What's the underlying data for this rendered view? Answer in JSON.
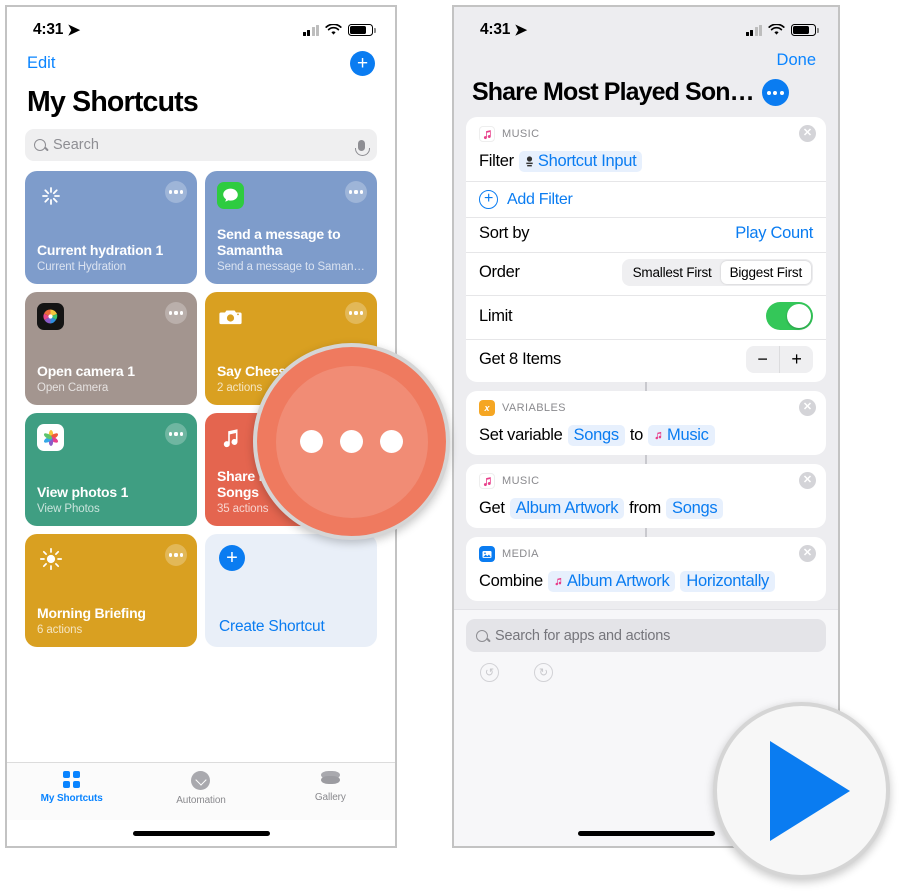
{
  "left_phone": {
    "status": {
      "time": "4:31",
      "location_arrow": "➤",
      "battery_pct": 70
    },
    "nav": {
      "edit_label": "Edit",
      "add_icon": "+"
    },
    "title": "My Shortcuts",
    "search": {
      "placeholder": "Search",
      "icon": "search-icon",
      "mic_icon": "microphone-icon"
    },
    "cards": [
      {
        "title": "Current hydration 1",
        "subtitle": "Current Hydration",
        "color": "#7e9ccb",
        "icon": "sparkle-icon",
        "glyph": "✳",
        "icon_bg": "transparent"
      },
      {
        "title": "Send a message to Samantha",
        "subtitle": "Send a message to Saman…",
        "color": "#7e9ccb",
        "icon": "messages-app-icon",
        "glyph": "💬",
        "icon_bg": "#2ecc40"
      },
      {
        "title": "Open camera 1",
        "subtitle": "Open Camera",
        "color": "#a3958f",
        "icon": "photos-editor-icon",
        "glyph": "◉",
        "icon_bg": "#1c1c1e"
      },
      {
        "title": "Say Cheese",
        "subtitle": "2 actions",
        "color": "#d9a021",
        "icon": "camera-icon",
        "glyph": "📷",
        "icon_bg": "transparent"
      },
      {
        "title": "View photos 1",
        "subtitle": "View Photos",
        "color": "#3f9e82",
        "icon": "photos-app-icon",
        "glyph": "❀",
        "icon_bg": "#ffffff"
      },
      {
        "title": "Share Most Played Songs",
        "subtitle": "35 actions",
        "color": "#e4654f",
        "icon": "music-note-icon",
        "glyph": "♫",
        "icon_bg": "transparent"
      },
      {
        "title": "Morning Briefing",
        "subtitle": "6 actions",
        "color": "#d9a021",
        "icon": "sun-icon",
        "glyph": "☀",
        "icon_bg": "transparent"
      }
    ],
    "create_card": {
      "label": "Create Shortcut",
      "icon": "plus-icon"
    },
    "tabs": [
      {
        "label": "My Shortcuts",
        "icon": "grid-icon",
        "active": true
      },
      {
        "label": "Automation",
        "icon": "clock-chevron-icon",
        "active": false
      },
      {
        "label": "Gallery",
        "icon": "layers-icon",
        "active": false
      }
    ]
  },
  "right_phone": {
    "status": {
      "time": "4:31",
      "location_arrow": "➤",
      "battery_pct": 70
    },
    "nav": {
      "done_label": "Done"
    },
    "title": "Share Most Played Son…",
    "more_button": "more-options-button",
    "action_cards": [
      {
        "app": "MUSIC",
        "app_icon": "music-note-icon",
        "app_icon_bg": "#ffffff",
        "rows": [
          {
            "type": "tokens",
            "label": "Filter",
            "token": "Shortcut Input",
            "token_icon": "shortcut-input-icon"
          },
          {
            "type": "add",
            "label": "Add Filter",
            "icon": "circle-plus-icon"
          },
          {
            "type": "value",
            "label": "Sort by",
            "value": "Play Count"
          },
          {
            "type": "segment",
            "label": "Order",
            "options": [
              "Smallest First",
              "Biggest First"
            ],
            "selected": "Biggest First"
          },
          {
            "type": "toggle",
            "label": "Limit",
            "on": true
          },
          {
            "type": "stepper",
            "label": "Get 8 Items",
            "minus": "−",
            "plus": "+"
          }
        ]
      },
      {
        "app": "VARIABLES",
        "app_icon": "variable-x-icon",
        "app_icon_bg": "#f5a623",
        "rows": [
          {
            "type": "sentence",
            "parts": [
              {
                "kind": "text",
                "text": "Set variable"
              },
              {
                "kind": "token",
                "text": "Songs"
              },
              {
                "kind": "text",
                "text": "to"
              },
              {
                "kind": "token",
                "text": "Music",
                "icon": "music-note-icon"
              }
            ]
          }
        ]
      },
      {
        "app": "MUSIC",
        "app_icon": "music-note-icon",
        "app_icon_bg": "#ffffff",
        "rows": [
          {
            "type": "sentence",
            "parts": [
              {
                "kind": "text",
                "text": "Get"
              },
              {
                "kind": "token",
                "text": "Album Artwork"
              },
              {
                "kind": "text",
                "text": "from"
              },
              {
                "kind": "token",
                "text": "Songs"
              }
            ]
          }
        ]
      },
      {
        "app": "MEDIA",
        "app_icon": "media-image-icon",
        "app_icon_bg": "#0a7cf1",
        "rows": [
          {
            "type": "sentence",
            "parts": [
              {
                "kind": "text",
                "text": "Combine"
              },
              {
                "kind": "token",
                "text": "Album Artwork",
                "icon": "music-note-icon"
              },
              {
                "kind": "token",
                "text": "Horizontally"
              }
            ]
          }
        ]
      }
    ],
    "search": {
      "placeholder": "Search for apps and actions",
      "icon": "search-icon"
    },
    "toolbar": [
      {
        "name": "undo-button",
        "glyph": "↺"
      },
      {
        "name": "redo-button",
        "glyph": "↻"
      }
    ]
  },
  "callouts": {
    "dots": {
      "name": "more-options-callout",
      "color": "#ef7a5f",
      "dot_count": 3
    },
    "play": {
      "name": "run-shortcut-callout",
      "color": "#0a7cf1",
      "glyph": "▶"
    }
  }
}
